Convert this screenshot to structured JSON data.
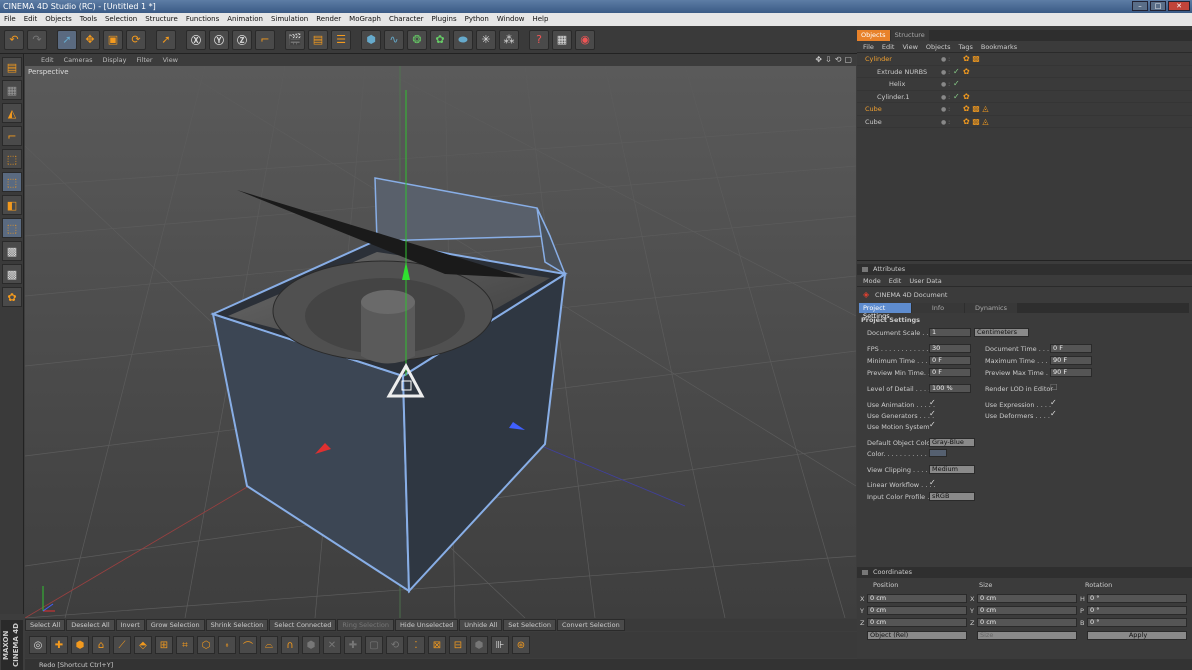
{
  "window": {
    "title": "CINEMA 4D Studio (RC) - [Untitled 1 *]"
  },
  "menubar": [
    "File",
    "Edit",
    "Objects",
    "Tools",
    "Selection",
    "Structure",
    "Functions",
    "Animation",
    "Simulation",
    "Render",
    "MoGraph",
    "Character",
    "Plugins",
    "Python",
    "Window",
    "Help"
  ],
  "viewport": {
    "menu": [
      "Edit",
      "Cameras",
      "Display",
      "Filter",
      "View"
    ],
    "label": "Perspective"
  },
  "objects_panel": {
    "tabs": [
      "Objects",
      "Structure"
    ],
    "menu": [
      "File",
      "Edit",
      "View",
      "Objects",
      "Tags",
      "Bookmarks"
    ],
    "items": [
      {
        "name": "Cylinder",
        "indent": 0,
        "highlight": true
      },
      {
        "name": "Extrude NURBS",
        "indent": 1,
        "highlight": false
      },
      {
        "name": "Helix",
        "indent": 2,
        "highlight": false
      },
      {
        "name": "Cylinder.1",
        "indent": 1,
        "highlight": false
      },
      {
        "name": "Cube",
        "indent": 0,
        "highlight": true
      },
      {
        "name": "Cube",
        "indent": 0,
        "highlight": false
      }
    ]
  },
  "attributes": {
    "header": "Attributes",
    "menu": [
      "Mode",
      "Edit",
      "User Data"
    ],
    "object_title": "CINEMA 4D Document",
    "tabs": [
      "Project Settings",
      "Info",
      "Dynamics"
    ],
    "section": "Project Settings",
    "document_scale_label": "Document Scale . . .",
    "document_scale_value": "1",
    "document_scale_unit": "Centimeters",
    "fps_label": "FPS . . . . . . . . . . . . .",
    "fps_value": "30",
    "min_time_label": "Minimum Time . . . . .",
    "min_time_value": "0 F",
    "preview_min_label": "Preview Min Time. . .",
    "preview_min_value": "0 F",
    "doc_time_label": "Document Time . . . .",
    "doc_time_value": "0 F",
    "max_time_label": "Maximum Time . . . .",
    "max_time_value": "90 F",
    "preview_max_label": "Preview Max Time . .",
    "preview_max_value": "90 F",
    "lod_label": "Level of Detail . . . .",
    "lod_value": "100 %",
    "render_lod_label": "Render LOD in Editor",
    "use_animation_label": "Use Animation . . . . .",
    "use_generators_label": "Use Generators . . . .",
    "use_motion_label": "Use Motion System",
    "use_expression_label": "Use Expression . . . .",
    "use_deformers_label": "Use Deformers . . . .",
    "default_color_label": "Default Object Color",
    "default_color_value": "Gray-Blue",
    "color_label": "Color. . . . . . . . . . . . .",
    "view_clipping_label": "View Clipping . . . . .",
    "view_clipping_value": "Medium",
    "linear_workflow_label": "Linear Workflow . . . .",
    "input_color_label": "Input Color Profile . . .",
    "input_color_value": "sRGB"
  },
  "coordinates": {
    "header": "Coordinates",
    "columns": [
      "Position",
      "Size",
      "Rotation"
    ],
    "rows": [
      {
        "axis": "X",
        "pos": "0 cm",
        "saxis": "X",
        "size": "0 cm",
        "raxis": "H",
        "rot": "0 °"
      },
      {
        "axis": "Y",
        "pos": "0 cm",
        "saxis": "Y",
        "size": "0 cm",
        "raxis": "P",
        "rot": "0 °"
      },
      {
        "axis": "Z",
        "pos": "0 cm",
        "saxis": "Z",
        "size": "0 cm",
        "raxis": "B",
        "rot": "0 °"
      }
    ],
    "mode": "Object (Rel)",
    "size_mode": "Size",
    "apply": "Apply"
  },
  "selection_bar": [
    "Select All",
    "Deselect All",
    "Invert",
    "Grow Selection",
    "Shrink Selection",
    "Select Connected",
    "Ring Selection",
    "Hide Unselected",
    "Unhide All",
    "Set Selection",
    "Convert Selection"
  ],
  "status": "Redo [Shortcut Ctrl+Y]",
  "logo": "MAXON CINEMA 4D"
}
